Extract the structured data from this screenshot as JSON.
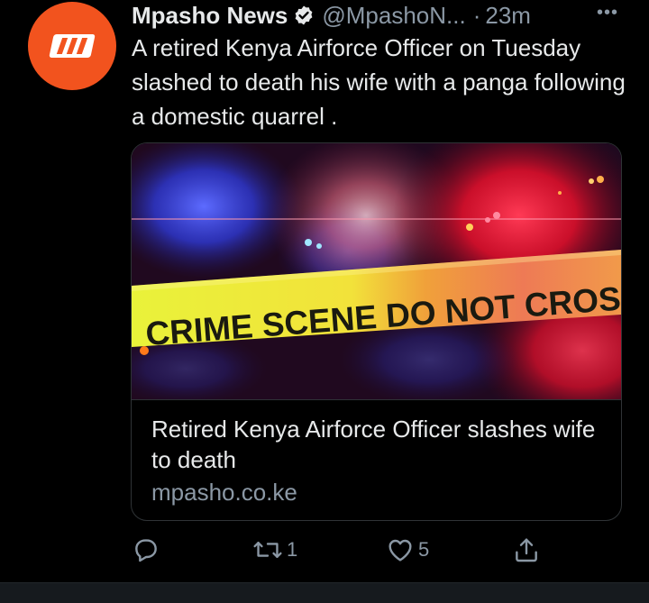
{
  "tweet": {
    "author_name": "Mpasho News",
    "handle": "@MpashoN...",
    "separator": "·",
    "time": "23m",
    "text": "A retired Kenya Airforce Officer on Tuesday slashed to death his wife with a panga following a domestic quarrel .",
    "avatar_color": "#f2531e"
  },
  "card": {
    "image_banner_text": "CRIME SCENE DO NOT CROSS",
    "title": "Retired Kenya Airforce Officer slashes wife to death",
    "domain": "mpasho.co.ke"
  },
  "actions": {
    "reply_icon": "reply-icon",
    "retweet_count": "1",
    "like_count": "5",
    "share_icon": "share-icon"
  },
  "colors": {
    "background": "#000000",
    "text_primary": "#e7e9ea",
    "text_secondary": "#8b98a5",
    "border": "#2f3336"
  }
}
